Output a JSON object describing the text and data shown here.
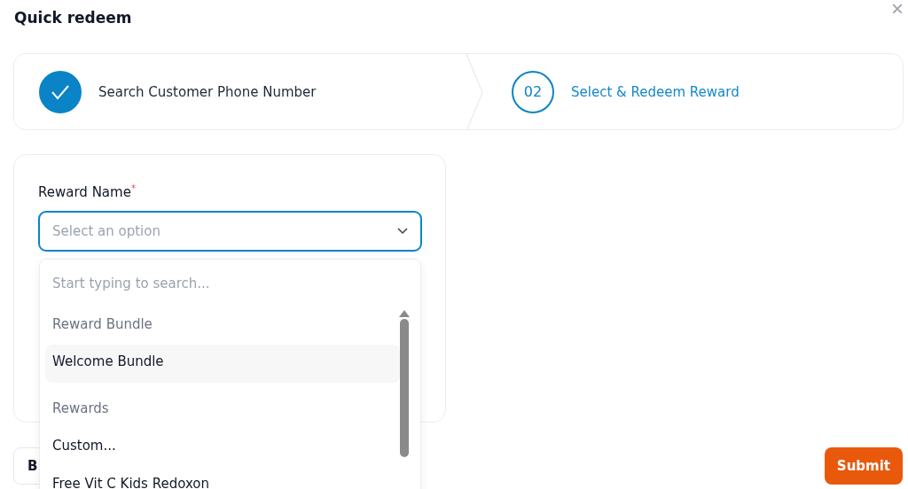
{
  "dialog": {
    "title": "Quick redeem",
    "close": "×"
  },
  "steps": [
    {
      "label": "Search Customer Phone Number",
      "completed": true
    },
    {
      "label": "Select & Redeem Reward",
      "completed": false,
      "number": "02"
    }
  ],
  "form": {
    "label": "Reward Name",
    "required_mark": "*",
    "select": {
      "placeholder": "Select an option",
      "expanded": true
    }
  },
  "dropdown": {
    "search_placeholder": "Start typing to search...",
    "items": [
      {
        "kind": "group",
        "label": "Reward Bundle"
      },
      {
        "kind": "option",
        "label": "Welcome Bundle",
        "selected": true
      },
      {
        "kind": "group",
        "label": "Rewards"
      },
      {
        "kind": "option",
        "label": "Custom...",
        "selected": false
      },
      {
        "kind": "option",
        "label": "Free Vit C Kids Redoxon",
        "selected": false
      }
    ]
  },
  "footer": {
    "back": "B",
    "submit": "Submit"
  }
}
